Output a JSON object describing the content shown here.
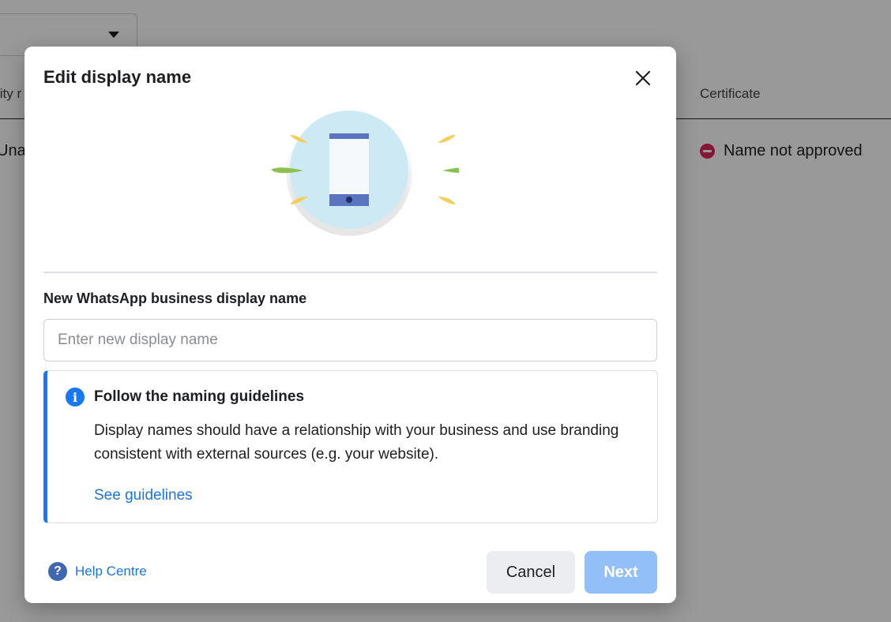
{
  "background": {
    "column_left_partial": "lity r",
    "column_certificate": "Certificate",
    "cell_left_partial": "Unav",
    "status_text": "Name not approved",
    "status_icon": "no-entry-icon",
    "status_color": "#e0245e"
  },
  "modal": {
    "title": "Edit display name",
    "close_icon": "close-icon",
    "illustration": "phone-illustration",
    "field_label": "New WhatsApp business display name",
    "input": {
      "value": "",
      "placeholder": "Enter new display name"
    },
    "info": {
      "icon": "info-icon",
      "title": "Follow the naming guidelines",
      "body": "Display names should have a relationship with your business and use branding consistent with external sources (e.g. your website).",
      "link_label": "See guidelines"
    },
    "footer": {
      "help_icon": "question-icon",
      "help_label": "Help Centre",
      "cancel_label": "Cancel",
      "next_label": "Next"
    }
  },
  "colors": {
    "accent": "#1877f2",
    "link": "#1b74e4",
    "next_disabled": "#92bff8",
    "overlay": "rgba(0,0,0,0.40)"
  }
}
